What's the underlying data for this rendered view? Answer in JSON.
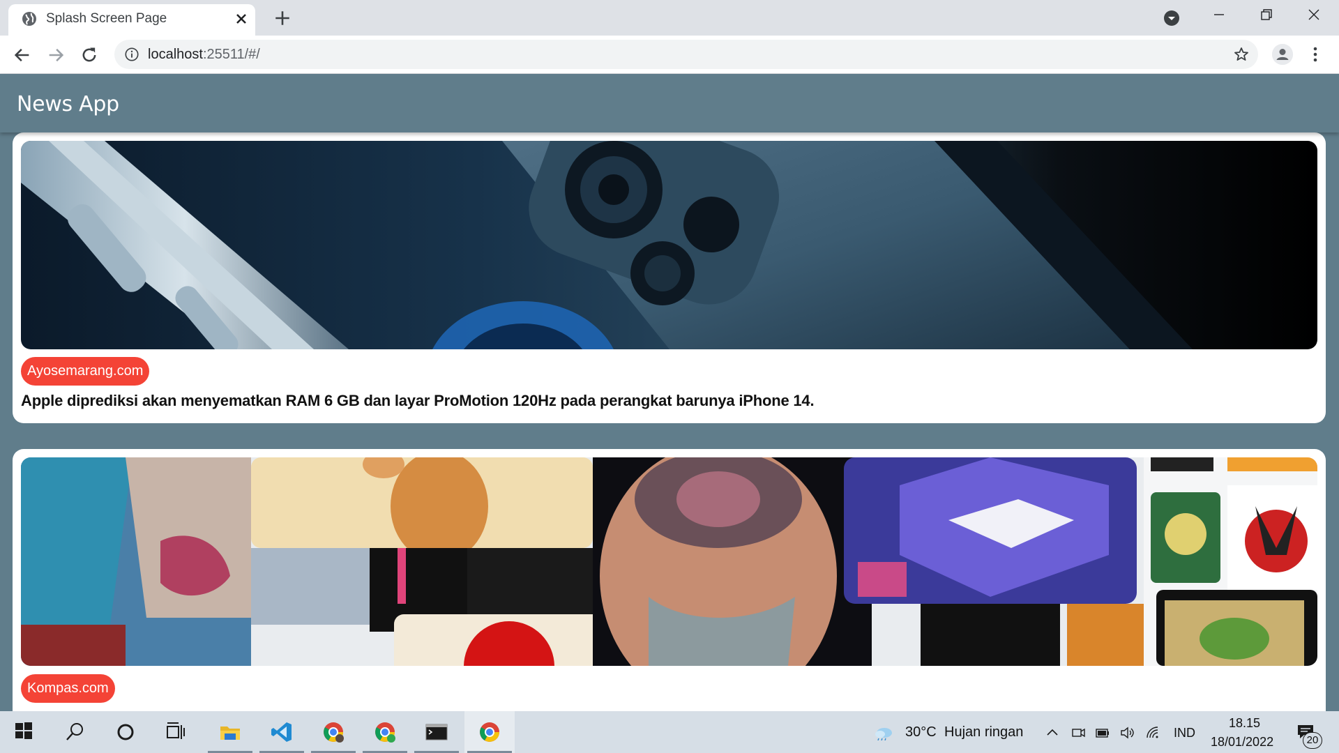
{
  "browser": {
    "tab_title": "Splash Screen Page",
    "url_host": "localhost",
    "url_path": ":25511/#/"
  },
  "app": {
    "title": "News App",
    "articles": [
      {
        "source": "Ayosemarang.com",
        "description": "Apple diprediksi akan menyematkan RAM 6 GB dan layar ProMotion 120Hz pada perangkat barunya iPhone 14.",
        "image": "iphone-image"
      },
      {
        "source": "Kompas.com",
        "description": "",
        "image": "nft-collage-image"
      }
    ],
    "colors": {
      "appbar": "#607d8b",
      "badge": "#f44336",
      "card": "#ffffff"
    }
  },
  "taskbar": {
    "apps": [
      "start-icon",
      "search-icon",
      "cortana-icon",
      "task-view-icon",
      "file-explorer-icon",
      "vscode-icon",
      "chrome-profile-icon",
      "chrome-green-icon",
      "terminal-icon",
      "chrome-icon"
    ],
    "weather_temp": "30°C",
    "weather_desc": "Hujan ringan",
    "language": "IND",
    "time": "18.15",
    "date": "18/01/2022",
    "notifications": "20"
  }
}
